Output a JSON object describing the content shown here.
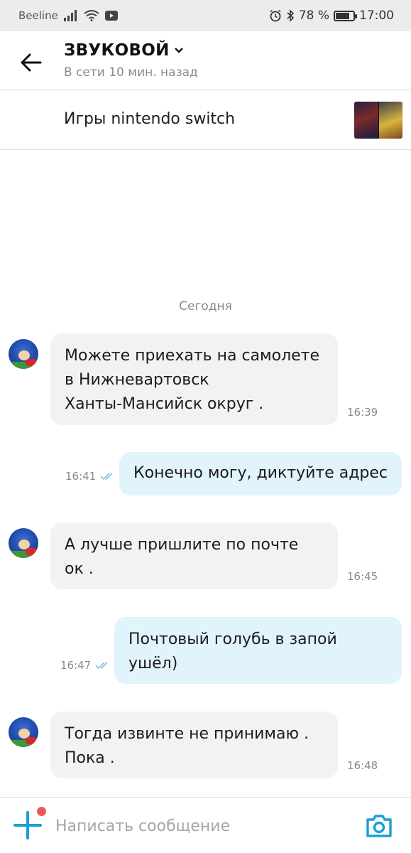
{
  "status_bar": {
    "carrier": "Beeline",
    "battery_text": "78 %",
    "battery_level": 0.78,
    "time": "17:00"
  },
  "header": {
    "name": "ЗВУКОВОЙ",
    "status": "В сети 10 мин. назад"
  },
  "listing": {
    "title": "Игры nintendo switch"
  },
  "date_separator": "Сегодня",
  "messages": [
    {
      "direction": "in",
      "text": "Можете приехать на самолете\nв Нижневартовск\nХанты-Мансийск округ .",
      "time": "16:39"
    },
    {
      "direction": "out",
      "text": "Конечно могу, диктуйте адрес",
      "time": "16:41",
      "read": true
    },
    {
      "direction": "in",
      "text": "А лучше пришлите по почте\nок .",
      "time": "16:45"
    },
    {
      "direction": "out",
      "text": "Почтовый голубь в запой\nушёл)",
      "time": "16:47",
      "read": true
    },
    {
      "direction": "in",
      "text": "Тогда извинте не принимаю .\nПока .",
      "time": "16:48"
    }
  ],
  "composer": {
    "placeholder": "Написать сообщение",
    "value": ""
  },
  "colors": {
    "accent": "#1a9fd6",
    "incoming_bubble": "#f2f2f2",
    "outgoing_bubble": "#e1f3fb",
    "read_check": "#7fc3e6",
    "notification_dot": "#ef5858"
  },
  "icons": {
    "back": "arrow-left-icon",
    "dropdown": "chevron-down-icon",
    "add": "plus-icon",
    "camera": "camera-icon",
    "read": "double-check-icon"
  }
}
